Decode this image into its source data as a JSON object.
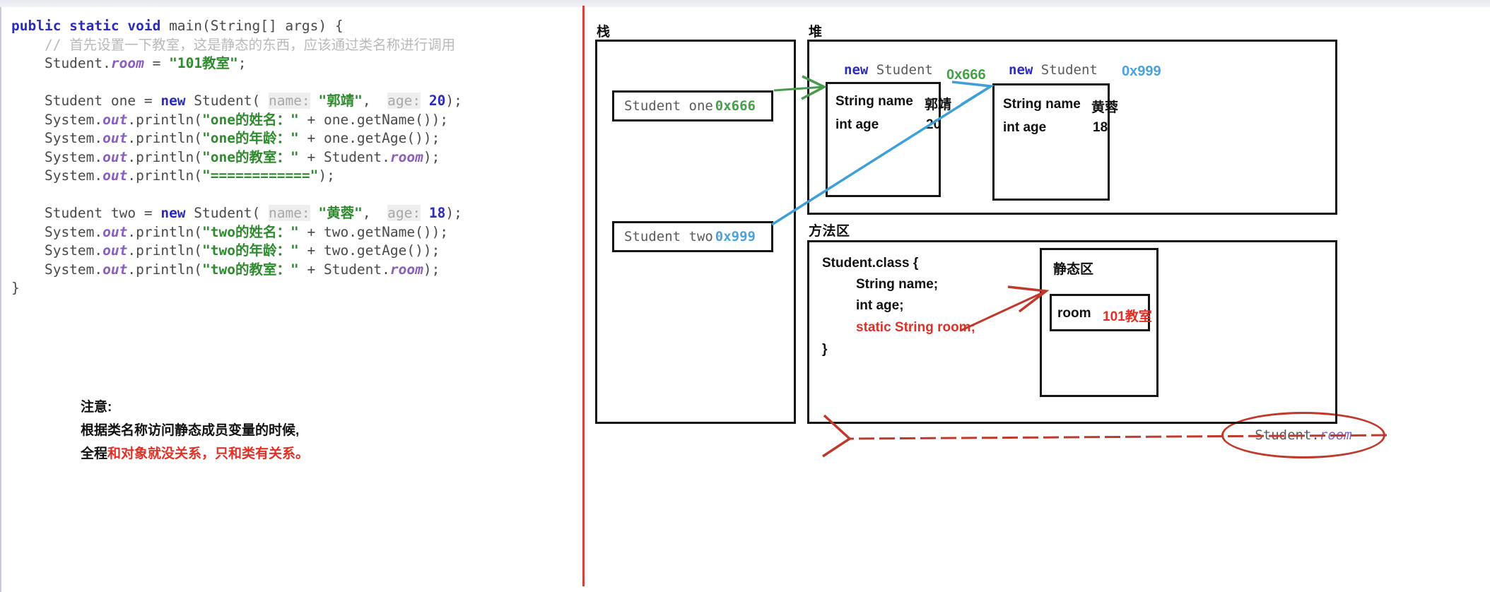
{
  "code": {
    "lines": [
      [
        {
          "t": "public static void ",
          "c": "kw"
        },
        {
          "t": "main(String[] args) {",
          "c": "plain"
        }
      ],
      [
        {
          "t": "    // 首先设置一下教室，这是静态的东西，应该通过类名称进行调用",
          "c": "cmt"
        }
      ],
      [
        {
          "t": "    Student.",
          "c": "plain"
        },
        {
          "t": "room",
          "c": "sfld"
        },
        {
          "t": " = ",
          "c": "plain"
        },
        {
          "t": "\"101教室\"",
          "c": "str"
        },
        {
          "t": ";",
          "c": "plain"
        }
      ],
      [
        {
          "t": "",
          "c": "plain"
        }
      ],
      [
        {
          "t": "    Student one = ",
          "c": "plain"
        },
        {
          "t": "new",
          "c": "kw2"
        },
        {
          "t": " Student( ",
          "c": "plain"
        },
        {
          "t": "name:",
          "c": "hint"
        },
        {
          "t": " ",
          "c": "plain"
        },
        {
          "t": "\"郭靖\"",
          "c": "str"
        },
        {
          "t": ",  ",
          "c": "plain"
        },
        {
          "t": "age:",
          "c": "hint"
        },
        {
          "t": " ",
          "c": "plain"
        },
        {
          "t": "20",
          "c": "num"
        },
        {
          "t": ");",
          "c": "plain"
        }
      ],
      [
        {
          "t": "    System.",
          "c": "plain"
        },
        {
          "t": "out",
          "c": "sfld"
        },
        {
          "t": ".println(",
          "c": "plain"
        },
        {
          "t": "\"one的姓名：\"",
          "c": "str"
        },
        {
          "t": " + one.getName());",
          "c": "plain"
        }
      ],
      [
        {
          "t": "    System.",
          "c": "plain"
        },
        {
          "t": "out",
          "c": "sfld"
        },
        {
          "t": ".println(",
          "c": "plain"
        },
        {
          "t": "\"one的年龄：\"",
          "c": "str"
        },
        {
          "t": " + one.getAge());",
          "c": "plain"
        }
      ],
      [
        {
          "t": "    System.",
          "c": "plain"
        },
        {
          "t": "out",
          "c": "sfld"
        },
        {
          "t": ".println(",
          "c": "plain"
        },
        {
          "t": "\"one的教室：\"",
          "c": "str"
        },
        {
          "t": " + Student.",
          "c": "plain"
        },
        {
          "t": "room",
          "c": "sfld"
        },
        {
          "t": ");",
          "c": "plain"
        }
      ],
      [
        {
          "t": "    System.",
          "c": "plain"
        },
        {
          "t": "out",
          "c": "sfld"
        },
        {
          "t": ".println(",
          "c": "plain"
        },
        {
          "t": "\"============\"",
          "c": "str"
        },
        {
          "t": ");",
          "c": "plain"
        }
      ],
      [
        {
          "t": "",
          "c": "plain"
        }
      ],
      [
        {
          "t": "    Student two = ",
          "c": "plain"
        },
        {
          "t": "new",
          "c": "kw2"
        },
        {
          "t": " Student( ",
          "c": "plain"
        },
        {
          "t": "name:",
          "c": "hint"
        },
        {
          "t": " ",
          "c": "plain"
        },
        {
          "t": "\"黄蓉\"",
          "c": "str"
        },
        {
          "t": ",  ",
          "c": "plain"
        },
        {
          "t": "age:",
          "c": "hint"
        },
        {
          "t": " ",
          "c": "plain"
        },
        {
          "t": "18",
          "c": "num"
        },
        {
          "t": ");",
          "c": "plain"
        }
      ],
      [
        {
          "t": "    System.",
          "c": "plain"
        },
        {
          "t": "out",
          "c": "sfld"
        },
        {
          "t": ".println(",
          "c": "plain"
        },
        {
          "t": "\"two的姓名：\"",
          "c": "str"
        },
        {
          "t": " + two.getName());",
          "c": "plain"
        }
      ],
      [
        {
          "t": "    System.",
          "c": "plain"
        },
        {
          "t": "out",
          "c": "sfld"
        },
        {
          "t": ".println(",
          "c": "plain"
        },
        {
          "t": "\"two的年龄：\"",
          "c": "str"
        },
        {
          "t": " + two.getAge());",
          "c": "plain"
        }
      ],
      [
        {
          "t": "    System.",
          "c": "plain"
        },
        {
          "t": "out",
          "c": "sfld"
        },
        {
          "t": ".println(",
          "c": "plain"
        },
        {
          "t": "\"two的教室：\"",
          "c": "str"
        },
        {
          "t": " + Student.",
          "c": "plain"
        },
        {
          "t": "room",
          "c": "sfld"
        },
        {
          "t": ");",
          "c": "plain"
        }
      ],
      [
        {
          "t": "}",
          "c": "plain"
        }
      ]
    ]
  },
  "note": {
    "title": "注意:",
    "line1": "根据类名称访问静态成员变量的时候,",
    "line2_black": "全程",
    "line2_red": "和对象就没关系，只和类有关系。"
  },
  "diagram": {
    "stack": {
      "label": "栈",
      "vars": [
        {
          "name": "Student one",
          "addr": "0x666",
          "addr_color": "#46a049"
        },
        {
          "name": "Student two",
          "addr": "0x999",
          "addr_color": "#4ba3dc"
        }
      ],
      "annotation": {
        "prefix": "Student.",
        "field": "room"
      }
    },
    "heap": {
      "label": "堆",
      "objects": [
        {
          "new_kw": "new",
          "class_name": "Student",
          "addr": "0x666",
          "addr_color": "#46a049",
          "fields": [
            {
              "decl": "String name",
              "value": "郭靖"
            },
            {
              "decl": "int age",
              "value": "20"
            }
          ]
        },
        {
          "new_kw": "new",
          "class_name": "Student",
          "addr": "0x999",
          "addr_color": "#4ba3dc",
          "fields": [
            {
              "decl": "String name",
              "value": "黄蓉"
            },
            {
              "decl": "int age",
              "value": "18"
            }
          ]
        }
      ]
    },
    "method_area": {
      "label": "方法区",
      "class_lines": [
        {
          "text": "Student.class {",
          "red": false,
          "indent": 0
        },
        {
          "text": "String name;",
          "red": false,
          "indent": 1
        },
        {
          "text": "int age;",
          "red": false,
          "indent": 1
        },
        {
          "text": "static String room;",
          "red": true,
          "indent": 1
        },
        {
          "text": "}",
          "red": false,
          "indent": 0
        }
      ],
      "static_zone": {
        "label": "静态区",
        "entry_name": "room",
        "entry_value": "101教室"
      }
    }
  },
  "colors": {
    "divider_red": "#d0463e",
    "arrow_green": "#4a9a4e",
    "arrow_blue": "#3f9fd8",
    "arrow_red": "#c0392b",
    "box_border": "#141414"
  }
}
